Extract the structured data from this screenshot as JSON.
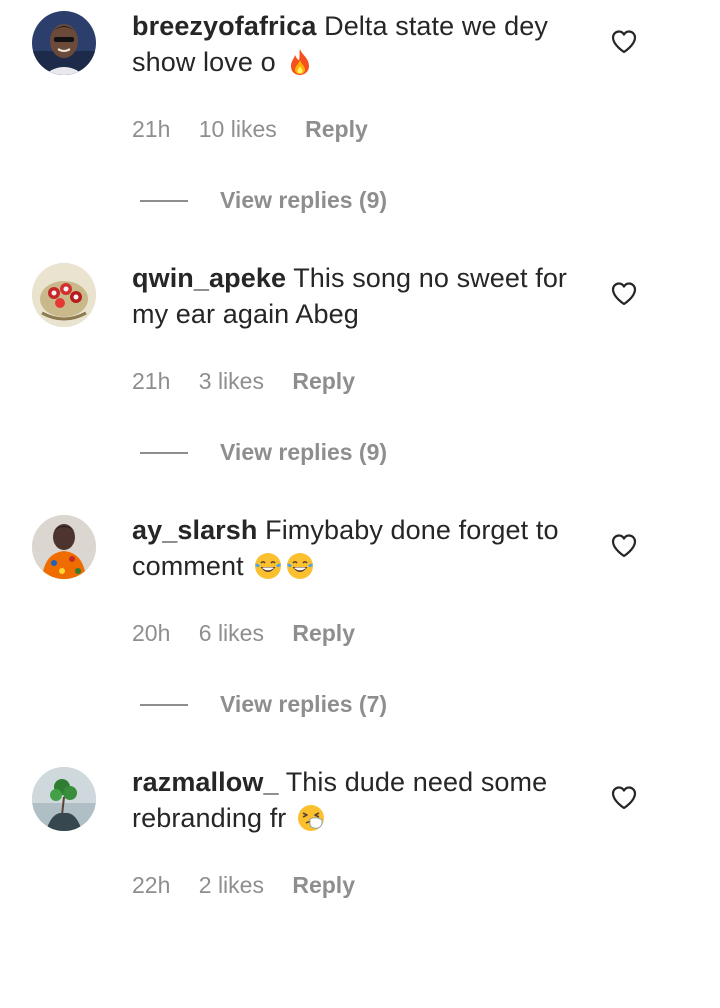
{
  "colors": {
    "text": "#262626",
    "muted": "#8e8e8e",
    "background": "#ffffff"
  },
  "comments": [
    {
      "username": "breezyofafrica",
      "text": "Delta state we dey show love o",
      "emoji": "fire-emoji",
      "time": "21h",
      "likes": "10 likes",
      "reply_label": "Reply",
      "view_replies": "View replies (9)"
    },
    {
      "username": "qwin_apeke",
      "text": "This song no sweet for my ear again Abeg",
      "time": "21h",
      "likes": "3 likes",
      "reply_label": "Reply",
      "view_replies": "View replies (9)"
    },
    {
      "username": "ay_slarsh",
      "text": "Fimybaby done forget to comment",
      "emoji": "tears-of-joy-emoji",
      "time": "20h",
      "likes": "6 likes",
      "reply_label": "Reply",
      "view_replies": "View replies (7)"
    },
    {
      "username": "razmallow_",
      "text": "This dude need some rebranding fr",
      "emoji": "sneezing-face-emoji",
      "time": "22h",
      "likes": "2 likes",
      "reply_label": "Reply"
    }
  ]
}
